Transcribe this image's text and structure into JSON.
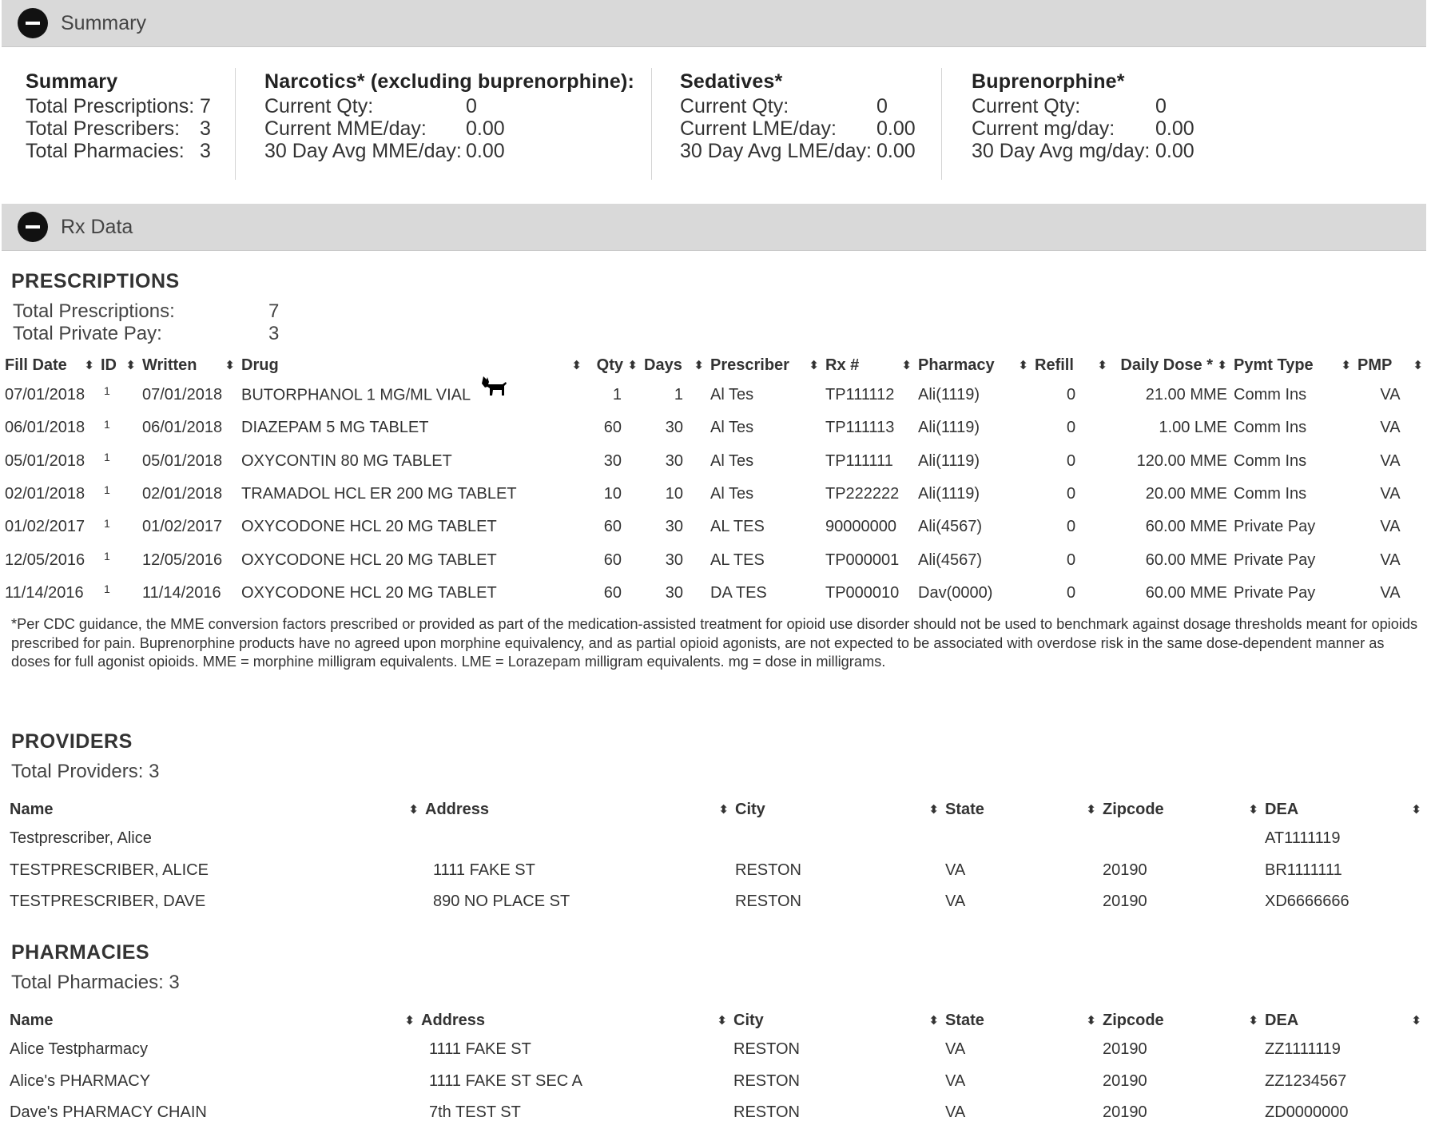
{
  "summary_panel": {
    "title": "Summary"
  },
  "summary": {
    "title": "Summary",
    "rows": [
      {
        "label": "Total Prescriptions:",
        "value": "7"
      },
      {
        "label": "Total Prescribers:",
        "value": "3"
      },
      {
        "label": "Total Pharmacies:",
        "value": "3"
      }
    ]
  },
  "narcotics": {
    "title": "Narcotics* (excluding buprenorphine):",
    "rows": [
      {
        "label": "Current Qty:",
        "value": "0"
      },
      {
        "label": "Current MME/day:",
        "value": "0.00"
      },
      {
        "label": "30 Day Avg MME/day:",
        "value": "0.00"
      }
    ]
  },
  "sedatives": {
    "title": "Sedatives*",
    "rows": [
      {
        "label": "Current Qty:",
        "value": "0"
      },
      {
        "label": "Current LME/day:",
        "value": "0.00"
      },
      {
        "label": "30 Day Avg LME/day:",
        "value": "0.00"
      }
    ]
  },
  "buprenorphine": {
    "title": "Buprenorphine*",
    "rows": [
      {
        "label": "Current Qty:",
        "value": "0"
      },
      {
        "label": "Current mg/day:",
        "value": "0.00"
      },
      {
        "label": "30 Day Avg mg/day:",
        "value": "0.00"
      }
    ]
  },
  "rx_panel": {
    "title": "Rx Data"
  },
  "prescriptions": {
    "title": "PRESCRIPTIONS",
    "total_label": "Total Prescriptions:",
    "total_value": "7",
    "private_label": "Total Private Pay:",
    "private_value": "3",
    "headers": [
      "Fill Date",
      "ID",
      "Written",
      "Drug",
      "Qty",
      "Days",
      "Prescriber",
      "Rx #",
      "Pharmacy",
      "Refill",
      "Daily Dose *",
      "Pymt Type",
      "PMP"
    ],
    "rows": [
      {
        "fill": "07/01/2018",
        "id": "1",
        "written": "07/01/2018",
        "drug": "BUTORPHANOL 1 MG/ML VIAL",
        "qty": "1",
        "days": "1",
        "prescriber": "Al Tes",
        "rx": "TP111112",
        "pharmacy": "Ali(1119)",
        "refill": "0",
        "dose": "21.00 MME",
        "pay": "Comm Ins",
        "pmp": "VA"
      },
      {
        "fill": "06/01/2018",
        "id": "1",
        "written": "06/01/2018",
        "drug": "DIAZEPAM 5 MG TABLET",
        "qty": "60",
        "days": "30",
        "prescriber": "Al Tes",
        "rx": "TP111113",
        "pharmacy": "Ali(1119)",
        "refill": "0",
        "dose": "1.00 LME",
        "pay": "Comm Ins",
        "pmp": "VA"
      },
      {
        "fill": "05/01/2018",
        "id": "1",
        "written": "05/01/2018",
        "drug": "OXYCONTIN 80 MG TABLET",
        "qty": "30",
        "days": "30",
        "prescriber": "Al Tes",
        "rx": "TP111111",
        "pharmacy": "Ali(1119)",
        "refill": "0",
        "dose": "120.00 MME",
        "pay": "Comm Ins",
        "pmp": "VA"
      },
      {
        "fill": "02/01/2018",
        "id": "1",
        "written": "02/01/2018",
        "drug": "TRAMADOL HCL ER 200 MG TABLET",
        "qty": "10",
        "days": "10",
        "prescriber": "Al Tes",
        "rx": "TP222222",
        "pharmacy": "Ali(1119)",
        "refill": "0",
        "dose": "20.00 MME",
        "pay": "Comm Ins",
        "pmp": "VA"
      },
      {
        "fill": "01/02/2017",
        "id": "1",
        "written": "01/02/2017",
        "drug": "OXYCODONE HCL 20 MG TABLET",
        "qty": "60",
        "days": "30",
        "prescriber": "AL TES",
        "rx": "90000000",
        "pharmacy": "Ali(4567)",
        "refill": "0",
        "dose": "60.00 MME",
        "pay": "Private Pay",
        "pmp": "VA"
      },
      {
        "fill": "12/05/2016",
        "id": "1",
        "written": "12/05/2016",
        "drug": "OXYCODONE HCL 20 MG TABLET",
        "qty": "60",
        "days": "30",
        "prescriber": "AL TES",
        "rx": "TP000001",
        "pharmacy": "Ali(4567)",
        "refill": "0",
        "dose": "60.00 MME",
        "pay": "Private Pay",
        "pmp": "VA"
      },
      {
        "fill": "11/14/2016",
        "id": "1",
        "written": "11/14/2016",
        "drug": "OXYCODONE HCL 20 MG TABLET",
        "qty": "60",
        "days": "30",
        "prescriber": "DA TES",
        "rx": "TP000010",
        "pharmacy": "Dav(0000)",
        "refill": "0",
        "dose": "60.00 MME",
        "pay": "Private Pay",
        "pmp": "VA"
      }
    ],
    "footnote": "*Per CDC guidance, the MME conversion factors prescribed or provided as part of the medication-assisted treatment for opioid use disorder should not be used to benchmark against dosage thresholds meant for opioids prescribed for pain. Buprenorphine products have no agreed upon morphine equivalency, and as partial opioid agonists, are not expected to be associated with overdose risk in the same dose-dependent manner as doses for full agonist opioids. MME = morphine milligram equivalents. LME = Lorazepam milligram equivalents. mg = dose in milligrams."
  },
  "providers": {
    "title": "PROVIDERS",
    "total_label": "Total Providers: 3",
    "headers": [
      "Name",
      "Address",
      "City",
      "State",
      "Zipcode",
      "DEA"
    ],
    "rows": [
      {
        "name": "Testprescriber, Alice",
        "address": "",
        "city": "",
        "state": "",
        "zip": "",
        "dea": "AT1111119"
      },
      {
        "name": "TESTPRESCRIBER, ALICE",
        "address": "1111 FAKE ST",
        "city": "RESTON",
        "state": "VA",
        "zip": "20190",
        "dea": "BR1111111"
      },
      {
        "name": "TESTPRESCRIBER, DAVE",
        "address": "890 NO PLACE ST",
        "city": "RESTON",
        "state": "VA",
        "zip": "20190",
        "dea": "XD6666666"
      }
    ]
  },
  "pharmacies": {
    "title": "PHARMACIES",
    "total_label": "Total Pharmacies: 3",
    "headers": [
      "Name",
      "Address",
      "City",
      "State",
      "Zipcode",
      "DEA"
    ],
    "rows": [
      {
        "name": "Alice Testpharmacy",
        "address": "1111 FAKE ST",
        "city": "RESTON",
        "state": "VA",
        "zip": "20190",
        "dea": "ZZ1111119"
      },
      {
        "name": "Alice's PHARMACY",
        "address": "1111 FAKE ST SEC A",
        "city": "RESTON",
        "state": "VA",
        "zip": "20190",
        "dea": "ZZ1234567"
      },
      {
        "name": "Dave's PHARMACY CHAIN",
        "address": "7th TEST ST",
        "city": "RESTON",
        "state": "VA",
        "zip": "20190",
        "dea": "ZD0000000"
      }
    ]
  },
  "icons": {
    "sort": "sort-icon",
    "collapse": "minus-circle-icon",
    "flag": "dog-icon"
  }
}
